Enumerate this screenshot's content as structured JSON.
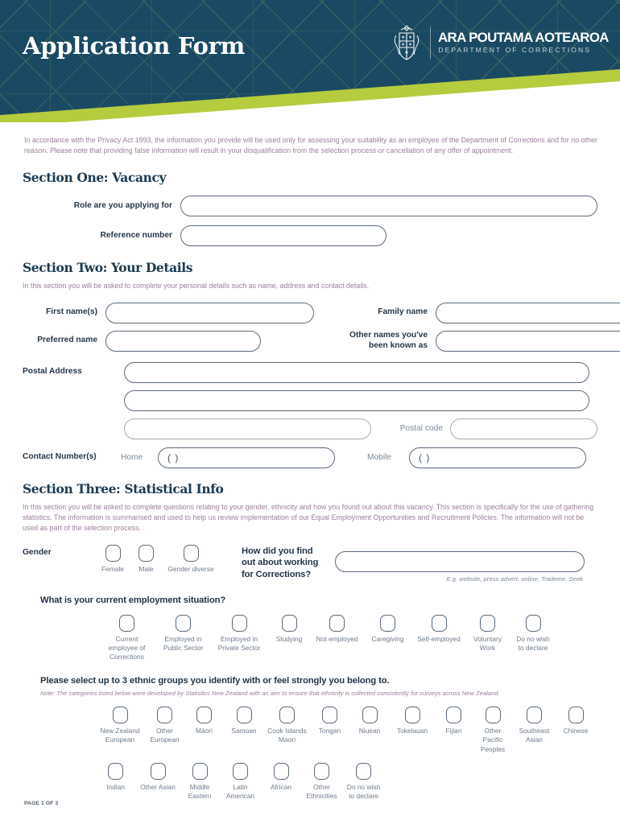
{
  "header": {
    "title": "Application Form",
    "logo_line1": "ARA POUTAMA AOTEAROA",
    "logo_line2": "DEPARTMENT OF CORRECTIONS",
    "colors": {
      "navy": "#1a4a63",
      "green": "#b5cc3f",
      "pattern": "#9fb25a"
    }
  },
  "privacy_notice": "In accordance with the Privacy Act 1993, the information you provide will be used only for assessing your suitability as an employee of the Department of Corrections and for no other reason. Please note that providing false information will result in your disqualification from the selection process or cancellation of any offer of appointment.",
  "section_one": {
    "heading": "Section One: Vacancy",
    "fields": [
      {
        "label": "Role are you applying for",
        "value": ""
      },
      {
        "label": "Reference number",
        "value": ""
      }
    ]
  },
  "section_two": {
    "heading": "Section Two: Your Details",
    "note": "In this section you will be asked to complete your personal details such as name, address and contact details.",
    "first_name_label": "First name(s)",
    "first_name_value": "",
    "family_name_label": "Family name",
    "family_name_value": "",
    "preferred_name_label": "Preferred name",
    "preferred_name_value": "",
    "other_names_label": "Other names you've\nbeen known as",
    "other_names_value": "",
    "postal_address_label": "Postal Address",
    "postal_address_line1": "",
    "postal_address_line2": "",
    "postal_address_line3": "",
    "postal_code_label": "Postal code",
    "postal_code_value": "",
    "contact_label": "Contact Number(s)",
    "home_label": "Home",
    "home_value": "(          )",
    "mobile_label": "Mobile",
    "mobile_value": "(          )"
  },
  "section_three": {
    "heading": "Section Three: Statistical Info",
    "note": "In this section you will be asked to complete questions relating to your gender, ethnicity and how you found out about this vacancy.  This section is specifically for the use of gathering statistics.  The information is summarised and used to help us review implementation of our Equal Employment Opportunities and Recruitment Policies.  The information will not be used as part of the selection process.",
    "gender_label": "Gender",
    "gender_options": [
      "Female",
      "Male",
      "Gender diverse"
    ],
    "how_found_label": "How did you find\nout about working\nfor Corrections?",
    "how_found_value": "",
    "how_found_hint": "E.g. website, press advert, online, Trademe, Seek",
    "employment_question": "What is your current employment situation?",
    "employment_options": [
      "Current\nemployee of\nCorrections",
      "Employed in\nPublic Sector",
      "Employed in\nPrivate Sector",
      "Studying",
      "Not employed",
      "Caregiving",
      "Self-employed",
      "Voluntary\nWork",
      "Do no wish\nto declare"
    ],
    "ethnicity_question": "Please select up to 3 ethnic groups you identify with or feel strongly you belong to.",
    "ethnicity_note": "Note: The categories listed below were developed by Statistics New Zealand with an aim to ensure that ethnicity is collected consistently for surveys across New Zealand.",
    "ethnicity_row1": [
      "New Zealand\nEuropean",
      "Other\nEuropean",
      "Māori",
      "Samoan",
      "Cook Islands\nMaori",
      "Tongan",
      "Niuean",
      "Tokelauan",
      "Fijian",
      "Other\nPacific\nPeoples",
      "Southeast\nAsian",
      "Chinese"
    ],
    "ethnicity_row2": [
      "Indian",
      "Other Asian",
      "Middle\nEastern",
      "Latin\nAmerican",
      "African",
      "Other\nEthnicities",
      "Do no wish\nto declare"
    ]
  },
  "footer": {
    "page_indicator": "PAGE 1 OF 3"
  }
}
